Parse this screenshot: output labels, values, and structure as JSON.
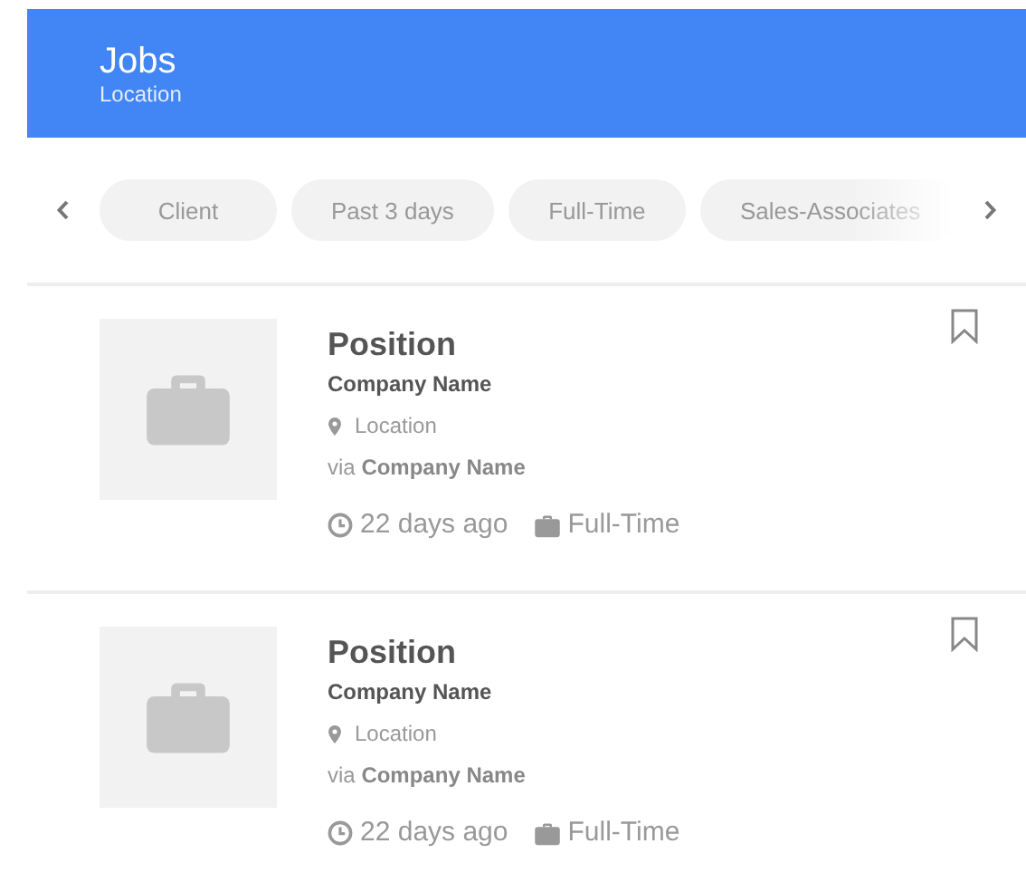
{
  "header": {
    "title": "Jobs",
    "subtitle": "Location"
  },
  "filters": [
    {
      "label": "Client"
    },
    {
      "label": "Past 3 days"
    },
    {
      "label": "Full-Time"
    },
    {
      "label": "Sales-Associates"
    }
  ],
  "jobs": [
    {
      "position": "Position",
      "company": "Company Name",
      "location": "Location",
      "via": "via **Company Name**",
      "posted": "22 days ago",
      "type": "Full-Time",
      "bookmarked": false
    },
    {
      "position": "Position",
      "company": "Company Name",
      "location": "Location",
      "via": "via **Company Name**",
      "posted": "22 days ago",
      "type": "Full-Time",
      "bookmarked": false
    }
  ]
}
